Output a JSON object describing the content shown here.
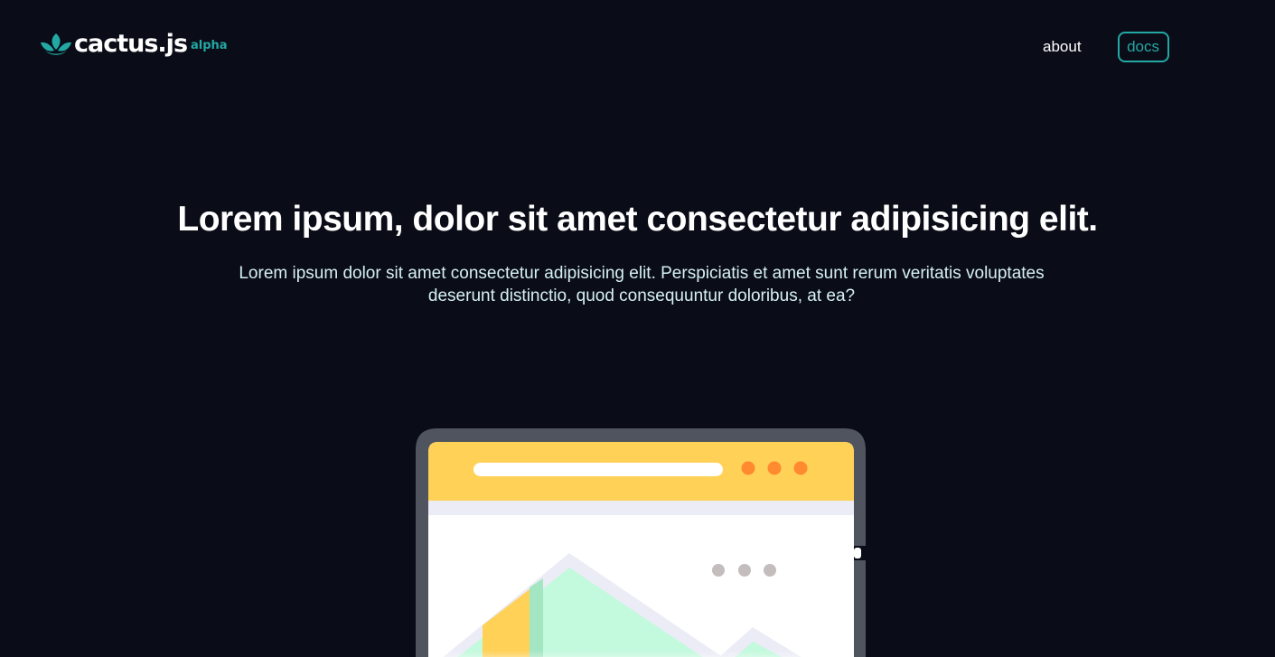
{
  "brand": {
    "name": "cactus.js",
    "badge": "alpha",
    "icon": "cactus-leaves-icon",
    "accent_color": "#23a8a4"
  },
  "nav": {
    "about_label": "about",
    "docs_label": "docs"
  },
  "hero": {
    "title": "Lorem ipsum, dolor sit amet consectetur adipisicing elit.",
    "subtitle": "Lorem ipsum dolor sit amet consectetur adipisicing elit. Perspiciatis et amet sunt rerum veritatis voluptates deserunt distinctio, quod consequuntur doloribus, at ea?"
  },
  "illustration": {
    "icon": "browser-window-landscape-icon",
    "colors": {
      "frame": "#4f545e",
      "header": "#ffd157",
      "dots": "#ff8a2f",
      "mountain": "#c3f9dc",
      "mountain_outline": "#ececf7"
    }
  }
}
